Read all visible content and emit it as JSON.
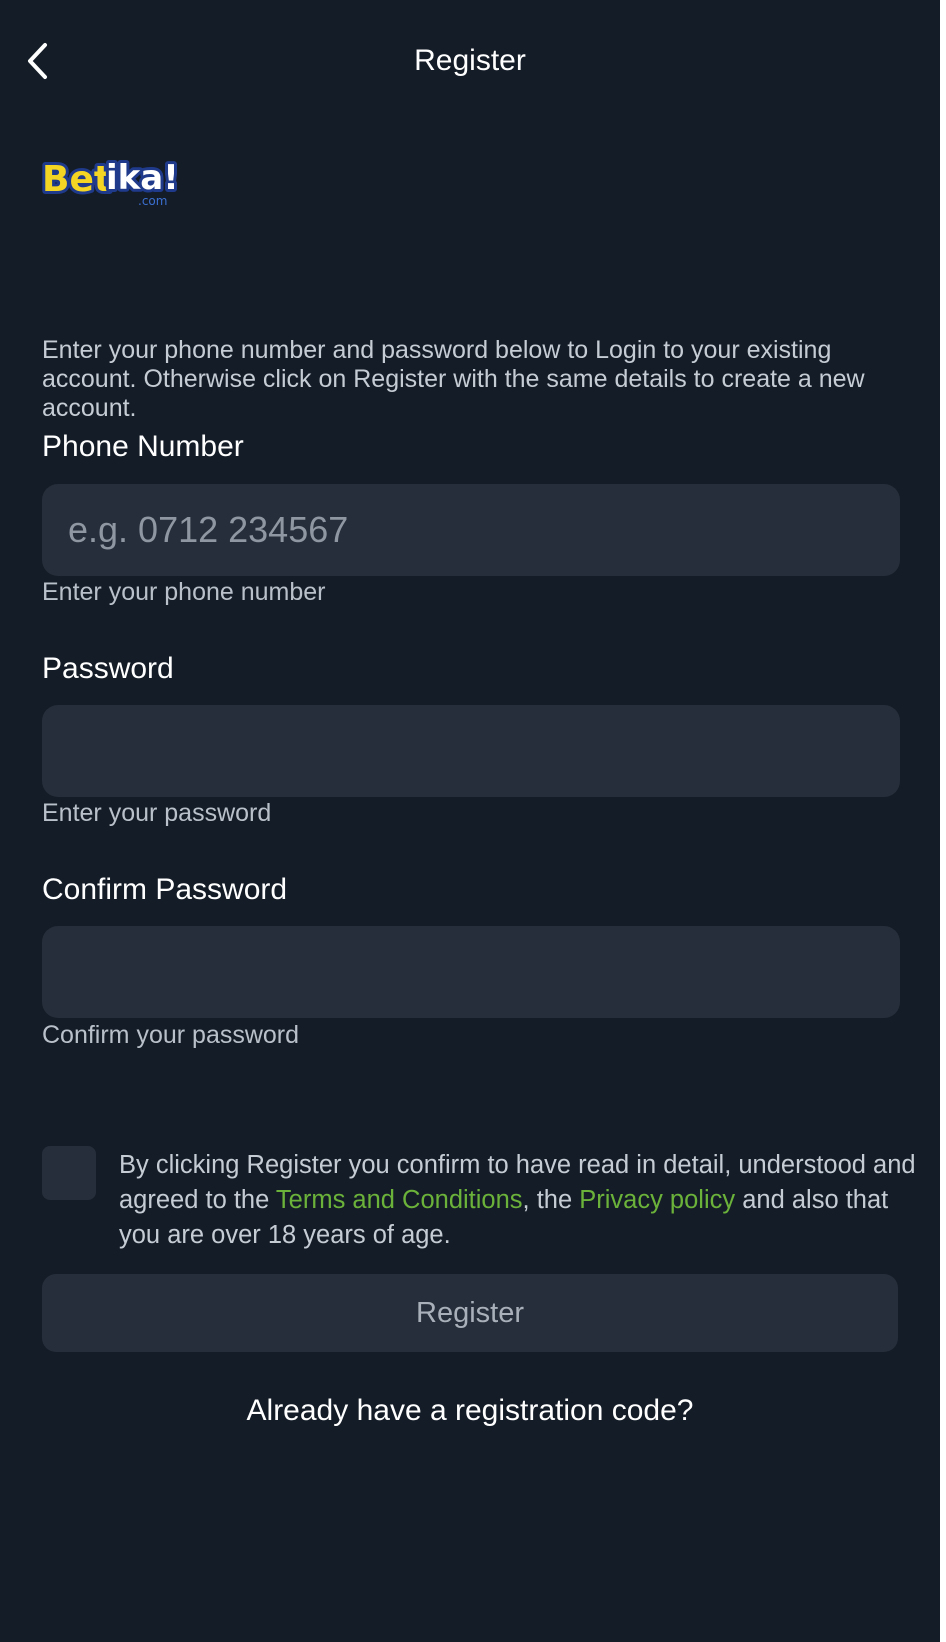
{
  "header": {
    "title": "Register",
    "back_icon": "chevron-left-icon"
  },
  "logo": {
    "text_bet": "Bet",
    "text_ika": "ika!",
    "text_domain": ".com",
    "colors": {
      "bet": "#f5d524",
      "ika": "#ffffff",
      "outline": "#1f3a8a"
    }
  },
  "intro": "Enter your phone number and password below to Login to your existing account. Otherwise click on Register with the same details to create a new account.",
  "phone": {
    "label": "Phone Number",
    "placeholder": "e.g. 0712 234567",
    "value": "",
    "helper": "Enter your phone number"
  },
  "password": {
    "label": "Password",
    "placeholder": "",
    "value": "",
    "helper": "Enter your password"
  },
  "confirm_password": {
    "label": "Confirm Password",
    "placeholder": "",
    "value": "",
    "helper": "Confirm your password"
  },
  "terms": {
    "checked": false,
    "text_1": "By clicking Register you confirm to have read in detail, understood and agreed to the ",
    "link_terms": "Terms and Conditions",
    "text_2": ", the ",
    "link_privacy": "Privacy policy",
    "text_3": " and also that you are over 18 years of age."
  },
  "register_button": "Register",
  "registration_code_link": "Already have a registration code?",
  "colors": {
    "background": "#141c27",
    "surface": "#252e3a",
    "link_green": "#6bb23a",
    "muted_text": "#c6ccd4"
  }
}
